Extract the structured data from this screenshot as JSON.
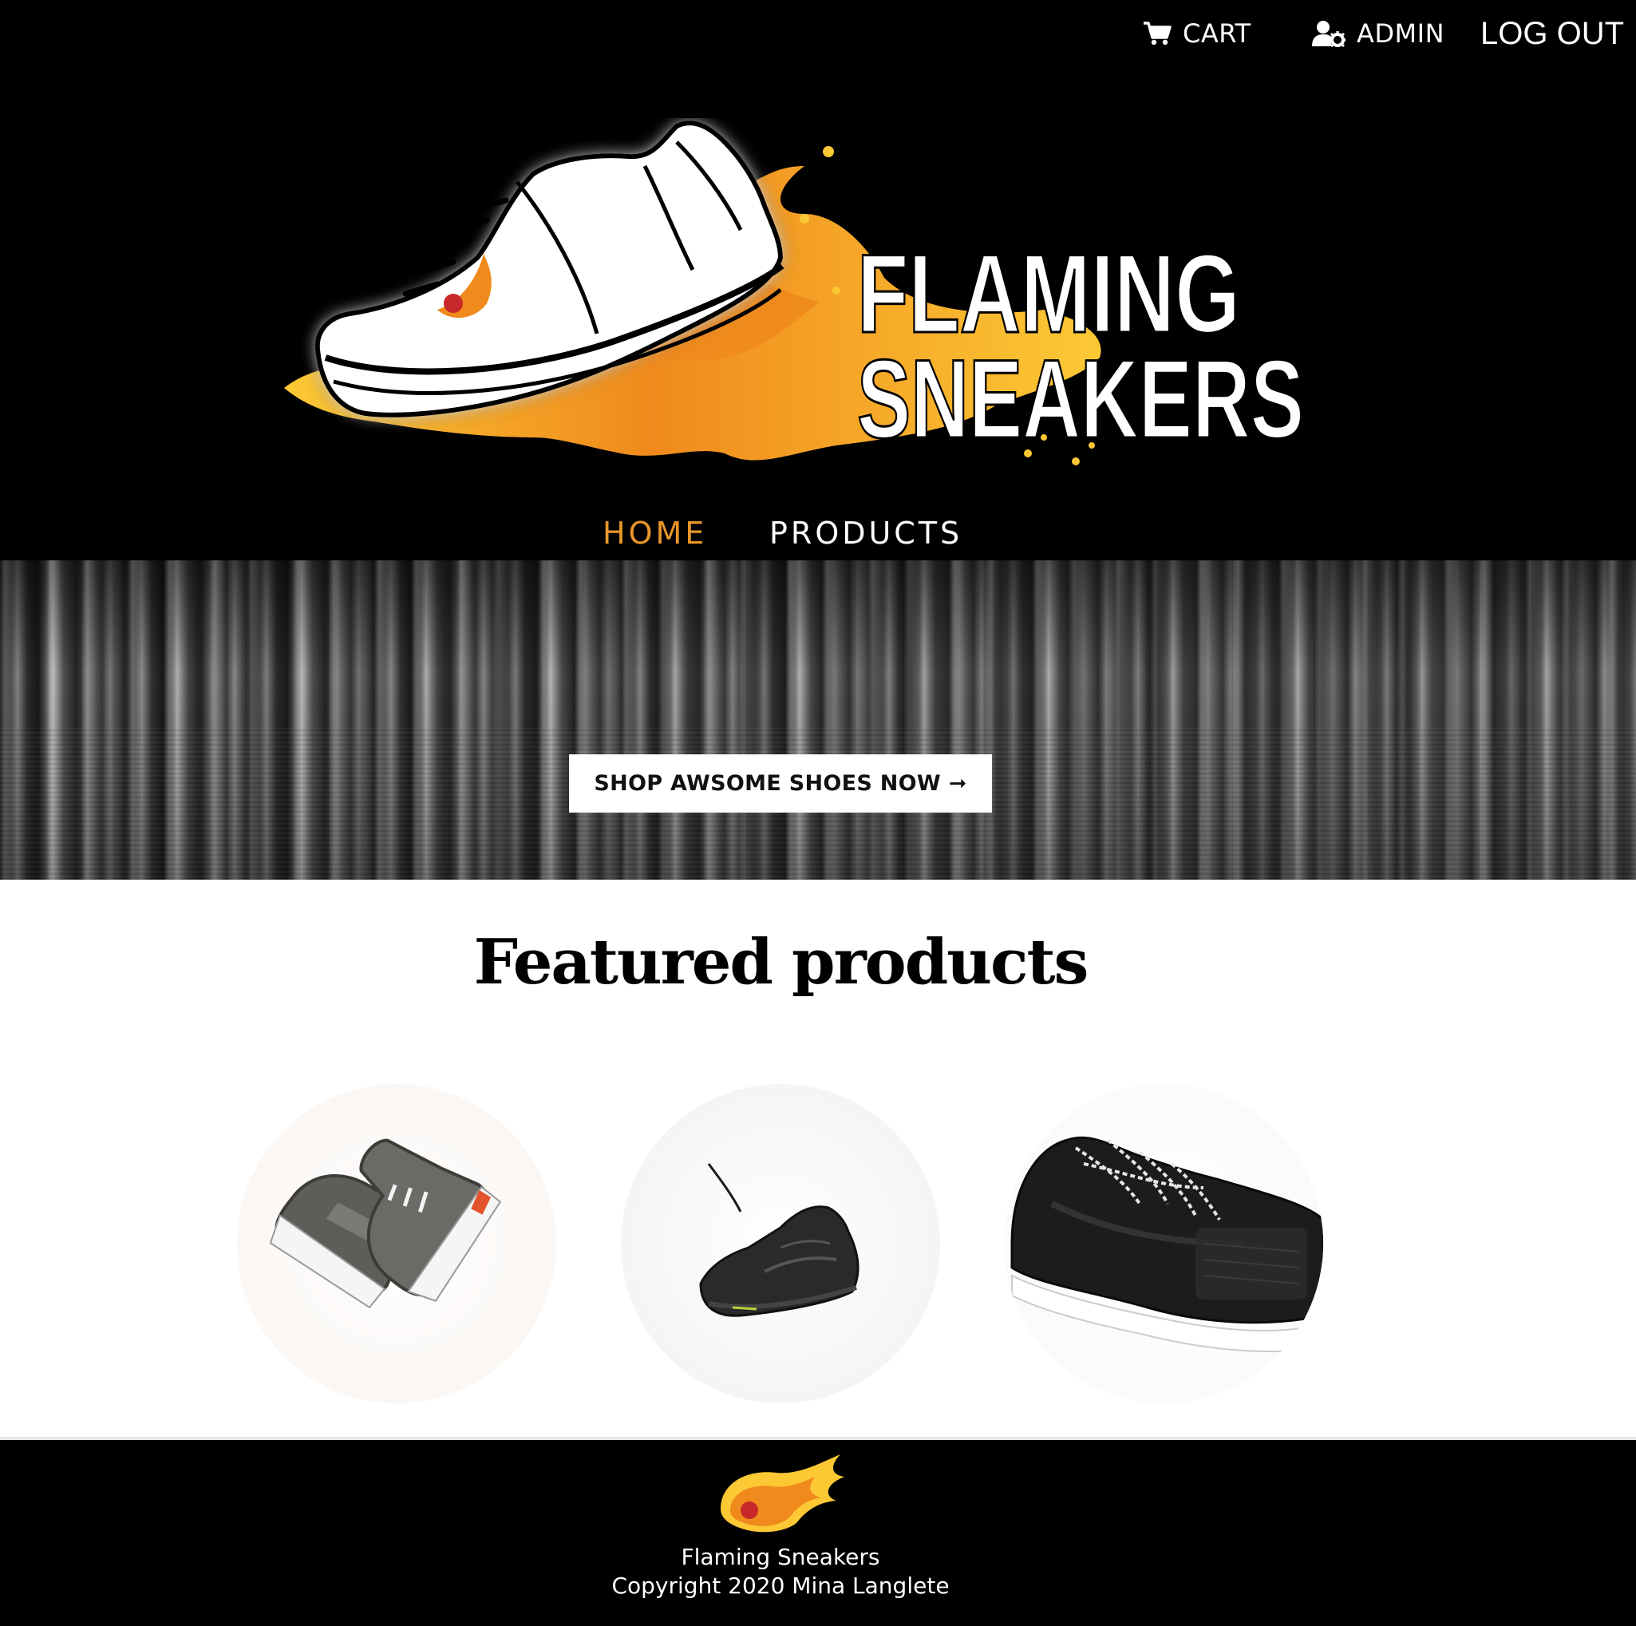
{
  "topbar": {
    "cart_label": "CART",
    "cart_icon": "cart-icon",
    "admin_label": "ADMIN",
    "admin_icon": "user-cog-icon",
    "logout_label": "LOG OUT"
  },
  "logo": {
    "line1": "FLAMING",
    "line2": "SNEAKERS"
  },
  "nav": {
    "items": [
      {
        "label": "HOME",
        "active": true
      },
      {
        "label": "PRODUCTS",
        "active": false
      }
    ]
  },
  "hero": {
    "cta_label": "SHOP AWSOME SHOES NOW ➞"
  },
  "featured": {
    "title": "Featured products"
  },
  "footer": {
    "name": "Flaming Sneakers",
    "copyright": "Copyright 2020 Mina Langlete"
  },
  "colors": {
    "accent": "#e8972a",
    "header_bg": "#000000",
    "flame_orange": "#f08a1c",
    "flame_yellow": "#fcc935"
  }
}
